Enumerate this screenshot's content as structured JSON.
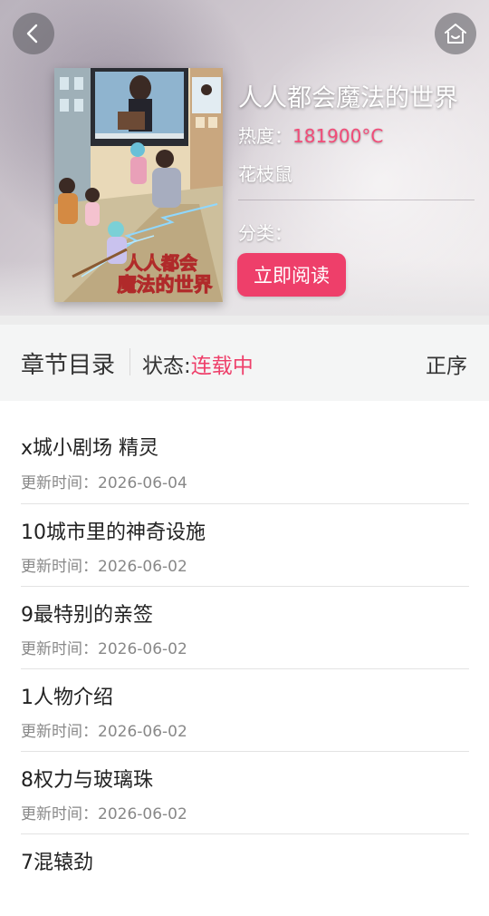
{
  "book": {
    "title": "人人都会魔法的世界",
    "heat_label": "热度：",
    "heat_value": "181900°C",
    "author": "花枝鼠",
    "category_label": "分类：",
    "read_button": "立即阅读",
    "cover_text_line1": "人人都会",
    "cover_text_line2": "魔法的世界"
  },
  "chapters_header": {
    "title": "章节目录",
    "status_label": "状态:",
    "status_value": "连载中",
    "order": "正序"
  },
  "chapters": [
    {
      "name": "x城小剧场 精灵",
      "time_label": "更新时间：",
      "time": "2026-06-04"
    },
    {
      "name": "10城市里的神奇设施",
      "time_label": "更新时间：",
      "time": "2026-06-02"
    },
    {
      "name": "9最特别的亲签",
      "time_label": "更新时间：",
      "time": "2026-06-02"
    },
    {
      "name": "1人物介绍",
      "time_label": "更新时间：",
      "time": "2026-06-02"
    },
    {
      "name": "8权力与玻璃珠",
      "time_label": "更新时间：",
      "time": "2026-06-02"
    },
    {
      "name": "7混辕劲",
      "time_label": "",
      "time": ""
    }
  ],
  "icons": {
    "back": "chevron-left-icon",
    "home": "home-icon"
  },
  "colors": {
    "accent": "#ee3f6a",
    "heat": "#f24b78"
  }
}
